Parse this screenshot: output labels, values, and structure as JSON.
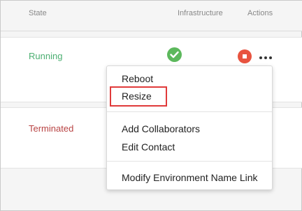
{
  "header": {
    "state": "State",
    "infrastructure": "Infrastructure",
    "actions": "Actions"
  },
  "rows": [
    {
      "state": "Running",
      "state_color": "#4caf72",
      "infra_icon": "check-circle-icon",
      "actions": [
        "stop-icon",
        "more-icon"
      ]
    },
    {
      "state": "Terminated",
      "state_color": "#b84343"
    }
  ],
  "menu": {
    "items": [
      {
        "label": "Reboot"
      },
      {
        "label": "Resize",
        "highlighted": true
      },
      {
        "label": "Add Collaborators"
      },
      {
        "label": "Edit Contact"
      },
      {
        "label": "Modify Environment Name Link"
      }
    ]
  },
  "colors": {
    "running": "#4caf72",
    "terminated": "#b84343",
    "check": "#5cb85c",
    "stop": "#e8533f",
    "highlight_border": "#e03a3a"
  }
}
